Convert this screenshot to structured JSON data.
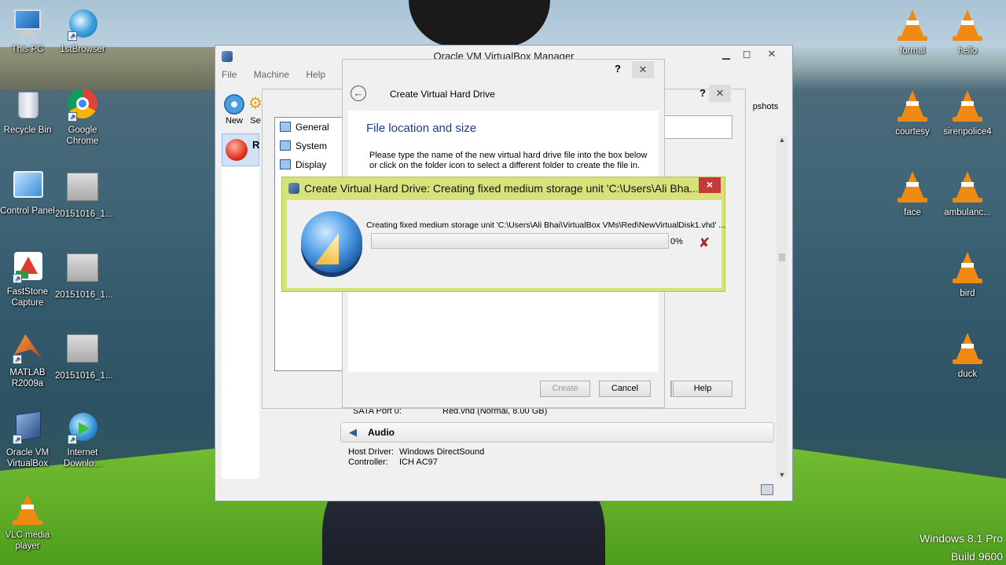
{
  "desktop": {
    "left_icons": [
      {
        "label": "This PC",
        "icon": "computer-icon"
      },
      {
        "label": "1stBrowser",
        "icon": "browser-icon"
      },
      {
        "label": "Recycle Bin",
        "icon": "recycle-bin-icon"
      },
      {
        "label": "Google Chrome",
        "icon": "chrome-icon"
      },
      {
        "label": "Control Panel",
        "icon": "control-panel-icon"
      },
      {
        "label": "20151016_1...",
        "icon": "file-icon"
      },
      {
        "label": "FastStone Capture",
        "icon": "faststone-icon"
      },
      {
        "label": "20151016_1...",
        "icon": "file-icon"
      },
      {
        "label": "MATLAB R2009a",
        "icon": "matlab-icon"
      },
      {
        "label": "20151016_1...",
        "icon": "file-icon"
      },
      {
        "label": "Oracle VM VirtualBox",
        "icon": "virtualbox-icon"
      },
      {
        "label": "Internet Downlo...",
        "icon": "idm-icon"
      },
      {
        "label": "VLC media player",
        "icon": "vlc-icon"
      }
    ],
    "right_icons": [
      {
        "label": "formal"
      },
      {
        "label": "hello"
      },
      {
        "label": "courtesy"
      },
      {
        "label": "sirenpolice4"
      },
      {
        "label": "face"
      },
      {
        "label": "ambulanc..."
      },
      {
        "label": "bird"
      },
      {
        "label": "duck"
      }
    ],
    "watermark": {
      "line1": "Windows 8.1 Pro",
      "line2": "Build 9600"
    }
  },
  "vbox_manager": {
    "title": "Oracle VM VirtualBox Manager",
    "menu": [
      "File",
      "Machine",
      "Help"
    ],
    "toolbar": {
      "new": "New",
      "settings": "Se",
      "snapshots": "pshots"
    },
    "vm_initial": "R",
    "storage_line": {
      "label": "SATA Port 0:",
      "value": "Red.vhd (Normal, 8.00 GB)"
    },
    "audio": {
      "header": "Audio",
      "host_driver_label": "Host Driver:",
      "host_driver_value": "Windows DirectSound",
      "controller_label": "Controller:",
      "controller_value": "ICH AC97"
    }
  },
  "settings_dialog": {
    "items": [
      "General",
      "System",
      "Display"
    ],
    "help_mark": "?",
    "help_button": "Help"
  },
  "wizard": {
    "title": "Create Virtual Hard Drive",
    "help_mark": "?",
    "heading": "File location and size",
    "description": "Please type the name of the new virtual hard drive file into the box below or click on the folder icon to select a different folder to create the file in.",
    "create_button": "Create",
    "cancel_button": "Cancel"
  },
  "progress_dialog": {
    "title": "Create Virtual Hard Drive: Creating fixed medium storage unit 'C:\\Users\\Ali Bha...",
    "message": "Creating fixed medium storage unit 'C:\\Users\\Ali Bhai\\VirtualBox VMs\\Red\\NewVirtualDisk1.vhd' ...",
    "percent_label": "0%",
    "progress": 0
  },
  "colors": {
    "progress_frame": "#d7e37a",
    "close_red": "#c7383a"
  }
}
